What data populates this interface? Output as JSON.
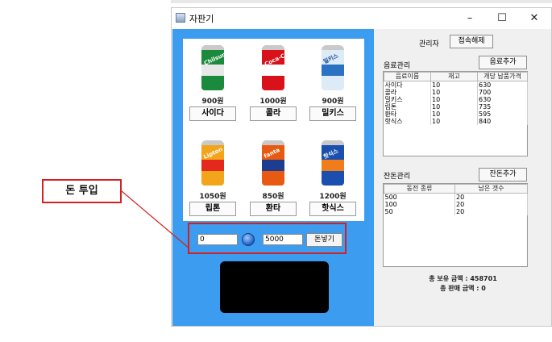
{
  "window": {
    "title": "자판기",
    "minimize": "–",
    "maximize": "☐",
    "close": "✕"
  },
  "products": [
    {
      "name": "사이다",
      "price": "900원",
      "brand": "Chilsung",
      "can_color": "#1c8a3c",
      "stripe_color": "#e8e8e8"
    },
    {
      "name": "콜라",
      "price": "1000원",
      "brand": "Coca-Cola",
      "can_color": "#d8111a",
      "stripe_color": "#ffffff"
    },
    {
      "name": "밀키스",
      "price": "900원",
      "brand": "밀키스",
      "can_color": "#dcebf5",
      "stripe_color": "#2b72c2"
    },
    {
      "name": "립톤",
      "price": "1050원",
      "brand": "Lipton",
      "can_color": "#f2a51a",
      "stripe_color": "#e5281e"
    },
    {
      "name": "환타",
      "price": "850원",
      "brand": "fanta",
      "can_color": "#e85a12",
      "stripe_color": "#1f3d8f"
    },
    {
      "name": "핫식스",
      "price": "1200원",
      "brand": "핫식스",
      "can_color": "#1a4fb0",
      "stripe_color": "#f07d1a"
    }
  ],
  "money": {
    "inserted_value": "0",
    "input_value": "5000",
    "insert_button": "돈넣기"
  },
  "callout": {
    "label": "돈 투입"
  },
  "admin": {
    "label": "관리자",
    "disconnect_button": "접속해제"
  },
  "drinks": {
    "section_title": "음료관리",
    "add_button": "음료추가",
    "columns": [
      "음료이름",
      "재고",
      "개당 납품가격"
    ],
    "rows": [
      [
        "사이다",
        "10",
        "630"
      ],
      [
        "콜라",
        "10",
        "700"
      ],
      [
        "밀키스",
        "10",
        "630"
      ],
      [
        "립톤",
        "10",
        "735"
      ],
      [
        "환타",
        "10",
        "595"
      ],
      [
        "핫식스",
        "10",
        "840"
      ]
    ]
  },
  "change": {
    "section_title": "잔돈관리",
    "add_button": "잔돈추가",
    "columns": [
      "동전 종류",
      "남은 갯수"
    ],
    "rows": [
      [
        "500",
        "20"
      ],
      [
        "100",
        "20"
      ],
      [
        "50",
        "20"
      ]
    ]
  },
  "totals": {
    "holding": "총 보유 금액 : 458701",
    "sales": "총 판매 금액 : 0"
  },
  "colors": {
    "panel_blue": "#3c9cf0",
    "callout_red": "#d42020"
  }
}
